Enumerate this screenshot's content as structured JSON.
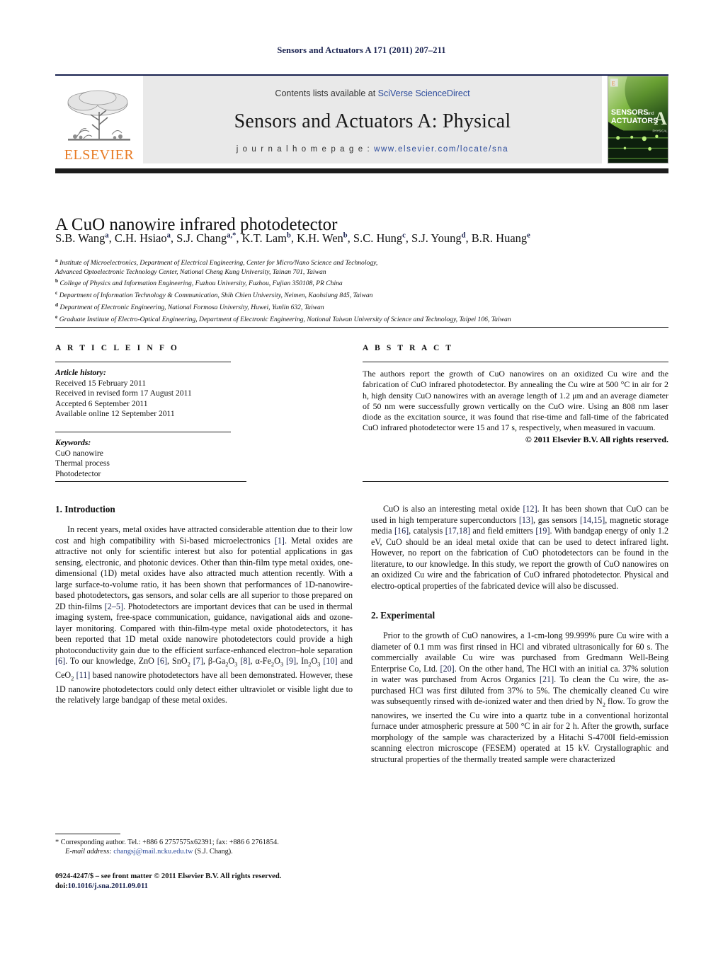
{
  "running_head": "Sensors and Actuators A 171 (2011) 207–211",
  "masthead": {
    "publisher_name": "ELSEVIER",
    "contents_prefix": "Contents lists available at ",
    "contents_link": "SciVerse ScienceDirect",
    "journal_title": "Sensors and Actuators A: Physical",
    "homepage_prefix": "j o u r n a l    h o m e p a g e :  ",
    "homepage_url": "www.elsevier.com/locate/sna",
    "cover": {
      "line1": "SENSORS",
      "line1_small": "and",
      "line2": "ACTUATORS",
      "letter": "A",
      "sub": "PHYSICAL"
    }
  },
  "article": {
    "title": "A CuO nanowire infrared photodetector",
    "authors": [
      {
        "name": "S.B. Wang",
        "sup": "a"
      },
      {
        "name": "C.H. Hsiao",
        "sup": "a"
      },
      {
        "name": "S.J. Chang",
        "sup": "a,*"
      },
      {
        "name": "K.T. Lam",
        "sup": "b"
      },
      {
        "name": "K.H. Wen",
        "sup": "b"
      },
      {
        "name": "S.C. Hung",
        "sup": "c"
      },
      {
        "name": "S.J. Young",
        "sup": "d"
      },
      {
        "name": "B.R. Huang",
        "sup": "e"
      }
    ],
    "affiliations": [
      {
        "sup": "a",
        "text": "Institute of Microelectronics, Department of Electrical Engineering, Center for Micro/Nano Science and Technology,"
      },
      {
        "sup": "",
        "text": "Advanced Optoelectronic Technology Center, National Cheng Kung University, Tainan 701, Taiwan"
      },
      {
        "sup": "b",
        "text": "College of Physics and Information Engineering, Fuzhou University, Fuzhou, Fujian 350108, PR China"
      },
      {
        "sup": "c",
        "text": "Department of Information Technology & Communication, Shih Chien University, Neimen, Kaohsiung 845, Taiwan"
      },
      {
        "sup": "d",
        "text": "Department of Electronic Engineering, National Formosa University, Huwei, Yunlin 632, Taiwan"
      },
      {
        "sup": "e",
        "text": "Graduate Institute of Electro-Optical Engineering, Department of Electronic Engineering, National Taiwan University of Science and Technology, Taipei 106, Taiwan"
      }
    ]
  },
  "article_info": {
    "section_label": "A R T I C L E    I N F O",
    "history_label": "Article history:",
    "history": [
      "Received 15 February 2011",
      "Received in revised form 17 August 2011",
      "Accepted 6 September 2011",
      "Available online 12 September 2011"
    ],
    "keywords_label": "Keywords:",
    "keywords": [
      "CuO nanowire",
      "Thermal process",
      "Photodetector"
    ]
  },
  "abstract": {
    "section_label": "A B S T R A C T",
    "text": "The authors report the growth of CuO nanowires on an oxidized Cu wire and the fabrication of CuO infrared photodetector. By annealing the Cu wire at 500 °C in air for 2 h, high density CuO nanowires with an average length of 1.2 μm and an average diameter of 50 nm were successfully grown vertically on the CuO wire. Using an 808 nm laser diode as the excitation source, it was found that rise-time and fall-time of the fabricated CuO infrared photodetector were 15 and 17 s, respectively, when measured in vacuum.",
    "copyright": "© 2011 Elsevier B.V. All rights reserved."
  },
  "sections": {
    "introduction": {
      "heading": "1.  Introduction",
      "paragraph1_parts": [
        "In recent years, metal oxides have attracted considerable attention due to their low cost and high compatibility with Si-based microelectronics ",
        "[1]",
        ". Metal oxides are attractive not only for scientific interest but also for potential applications in gas sensing, electronic, and photonic devices. Other than thin-film type metal oxides, one-dimensional (1D) metal oxides have also attracted much attention recently. With a large surface-to-volume ratio, it has been shown that performances of 1D-nanowire-based photodetectors, gas sensors, and solar cells are all superior to those prepared on 2D thin-films ",
        "[2–5]",
        ". Photodetectors are important devices that can be used in thermal imaging system, free-space communication, guidance, navigational aids and ozone-layer monitoring. Compared with thin-film-type metal oxide photodetectors, it has been reported that 1D metal oxide nanowire photodetectors could provide a high photoconductivity gain due to the efficient surface-enhanced electron–hole separation ",
        "[6]",
        ". To our knowledge, ZnO ",
        "[6]",
        ", SnO",
        "2",
        " ",
        "[7]",
        ", β-Ga",
        "2",
        "O",
        "3",
        " ",
        "[8]",
        ", α-Fe",
        "2",
        "O",
        "3",
        " ",
        "[9]",
        ", In",
        "2",
        "O",
        "3",
        " ",
        "[10]",
        " and CeO",
        "2",
        " ",
        "[11]",
        " based nanowire photodetectors have all been demonstrated. However, these 1D nanowire photodetectors could only detect either ultraviolet or visible light due to the relatively large bandgap of these metal oxides."
      ],
      "paragraph2_parts": [
        "CuO is also an interesting metal oxide ",
        "[12]",
        ". It has been shown that CuO can be used in high temperature superconductors ",
        "[13]",
        ", gas sensors ",
        "[14,15]",
        ", magnetic storage media ",
        "[16]",
        ", catalysis ",
        "[17,18]",
        " and field emitters ",
        "[19]",
        ". With bandgap energy of only 1.2 eV, CuO should be an ideal metal oxide that can be used to detect infrared light. However, no report on the fabrication of CuO photodetectors can be found in the literature, to our knowledge. In this study, we report the growth of CuO nanowires on an oxidized Cu wire and the fabrication of CuO infrared photodetector. Physical and electro-optical properties of the fabricated device will also be discussed."
      ]
    },
    "experimental": {
      "heading": "2.  Experimental",
      "paragraph1_parts": [
        "Prior to the growth of CuO nanowires, a 1-cm-long 99.999% pure Cu wire with a diameter of 0.1 mm was first rinsed in HCl and vibrated ultrasonically for 60 s. The commercially available Cu wire was purchased from Gredmann Well-Being Enterprise Co, Ltd. ",
        "[20]",
        ". On the other hand, The HCl with an initial ca. 37% solution in water was purchased from Acros Organics ",
        "[21]",
        ". To clean the Cu wire, the as-purchased HCl was first diluted from 37% to 5%. The chemically cleaned Cu wire was subsequently rinsed with de-ionized water and then dried by N",
        "2",
        " flow. To grow the nanowires, we inserted the Cu wire into a quartz tube in a conventional horizontal furnace under atmospheric pressure at 500 °C in air for 2 h. After the growth, surface morphology of the sample was characterized by a Hitachi S-4700I field-emission scanning electron microscope (FESEM) operated at 15 kV. Crystallographic and structural properties of the thermally treated sample were characterized"
      ]
    }
  },
  "footer": {
    "corresponding_marker": "*",
    "corresponding_text": " Corresponding author. Tel.: +886 6 2757575x62391; fax: +886 6 2761854.",
    "email_label": "E-mail address:",
    "email": "changsj@mail.ncku.edu.tw",
    "email_owner": " (S.J. Chang).",
    "issn_line": "0924-4247/$ – see front matter © 2011 Elsevier B.V. All rights reserved.",
    "doi_prefix": "doi:",
    "doi": "10.1016/j.sna.2011.09.011"
  },
  "colors": {
    "link_blue": "#2b4a9b",
    "ref_navy": "#17204e",
    "elsevier_orange": "#e87a22",
    "masthead_grey": "#e9e9e9"
  }
}
